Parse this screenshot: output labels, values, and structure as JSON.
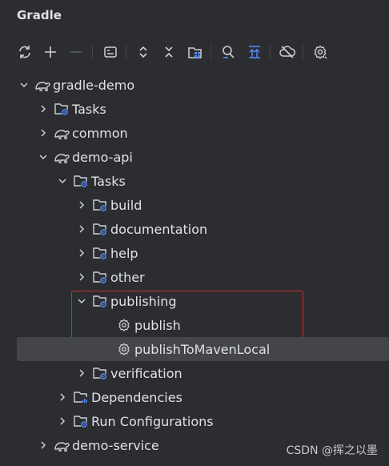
{
  "header": {
    "title": "Gradle"
  },
  "toolbar": {
    "buttons": [
      {
        "name": "reload-icon"
      },
      {
        "name": "add-icon"
      },
      {
        "name": "remove-icon"
      },
      {
        "name": "execute-task-icon"
      },
      {
        "name": "expand-all-icon"
      },
      {
        "name": "collapse-all-icon"
      },
      {
        "name": "group-modules-icon"
      },
      {
        "name": "analyze-dependencies-icon"
      },
      {
        "name": "toggle-offline-icon"
      },
      {
        "name": "disconnect-icon"
      },
      {
        "name": "settings-icon"
      }
    ]
  },
  "tree": {
    "root": "gradle-demo",
    "root_tasks": "Tasks",
    "common": "common",
    "demo_api": "demo-api",
    "api_tasks": "Tasks",
    "build": "build",
    "documentation": "documentation",
    "help": "help",
    "other": "other",
    "publishing": "publishing",
    "publish": "publish",
    "publish_local": "publishToMavenLocal",
    "verification": "verification",
    "dependencies": "Dependencies",
    "run_configurations": "Run Configurations",
    "demo_service": "demo-service"
  },
  "watermark": "CSDN @挥之以墨",
  "colors": {
    "background": "#2b2d30",
    "selection": "#43454a",
    "highlight_border": "#c9312f",
    "text": "#dfe1e5",
    "icon_gray": "#ced0d6",
    "icon_blue": "#548af7"
  }
}
